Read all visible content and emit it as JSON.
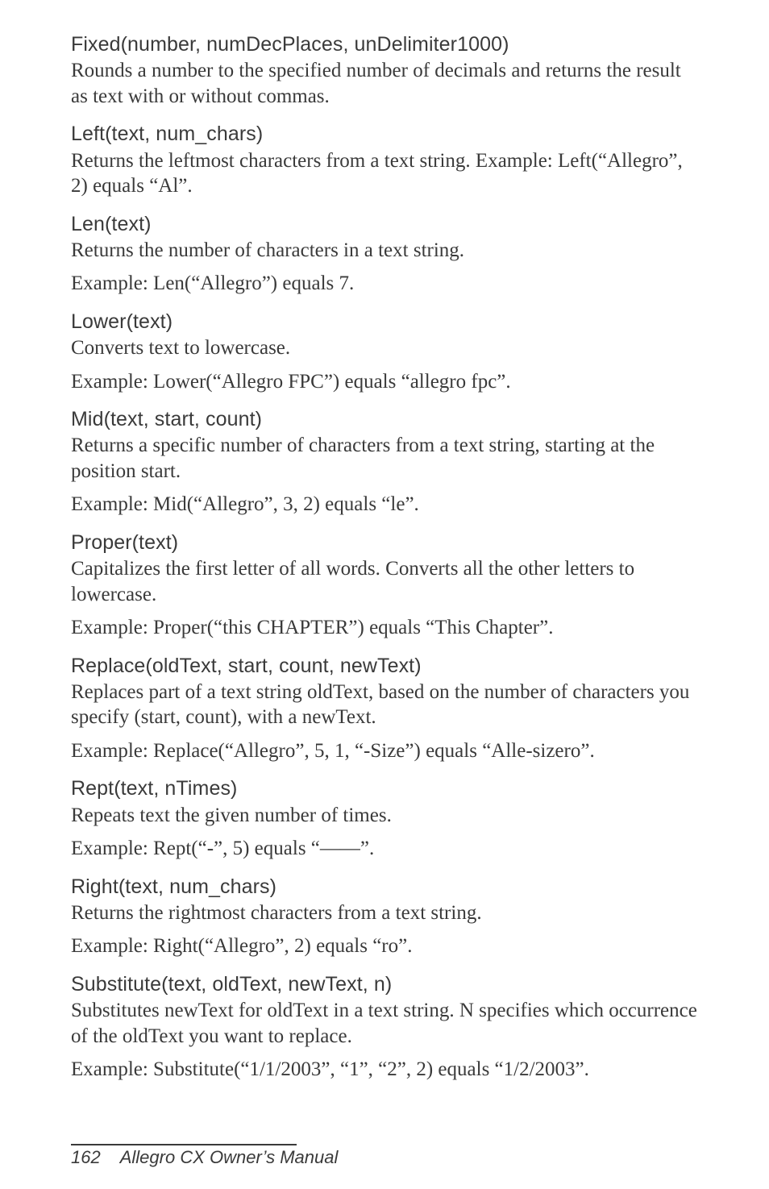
{
  "sections": [
    {
      "title": "Fixed(number, numDecPlaces, unDelimiter1000)",
      "paras": [
        "Rounds a number to the specified number of decimals and returns the result as text with or without commas."
      ]
    },
    {
      "title": "Left(text, num_chars)",
      "paras": [
        "Returns the leftmost characters from a text string. Example: Left(“Allegro”, 2) equals “Al”."
      ]
    },
    {
      "title": "Len(text)",
      "paras": [
        "Returns the number of characters in a text string.",
        "Example: Len(“Allegro”) equals 7."
      ]
    },
    {
      "title": "Lower(text)",
      "paras": [
        "Converts text to lowercase.",
        "Example: Lower(“Allegro FPC”) equals “allegro fpc”."
      ]
    },
    {
      "title": "Mid(text, start, count)",
      "paras": [
        "Returns a specific number of characters from a text string, starting at the position start.",
        "Example: Mid(“Allegro”, 3, 2) equals “le”."
      ]
    },
    {
      "title": "Proper(text)",
      "paras": [
        "Capitalizes the first letter of all words. Converts all the other letters to lowercase.",
        "Example: Proper(“this CHAPTER”) equals “This Chapter”."
      ]
    },
    {
      "title": "Replace(oldText, start, count, newText)",
      "paras": [
        "Replaces part of a text string oldText, based on the number of characters you specify (start, count), with a newText.",
        "Example: Replace(“Allegro”, 5, 1, “-Size”) equals “Alle-sizero”."
      ]
    },
    {
      "title": "Rept(text, nTimes)",
      "paras": [
        "Repeats text the given number of times.",
        "Example: Rept(“-”, 5) equals “——”."
      ]
    },
    {
      "title": "Right(text, num_chars)",
      "paras": [
        "Returns the rightmost characters from a text string.",
        "Example: Right(“Allegro”, 2) equals “ro”."
      ]
    },
    {
      "title": "Substitute(text, oldText, newText, n)",
      "paras": [
        "Substitutes newText for oldText in a text string. N specifies which occurrence of the oldText you want to replace.",
        "Example: Substitute(“1/1/2003”, “1”, “2”, 2) equals “1/2/2003”."
      ]
    }
  ],
  "footer": {
    "page": "162",
    "title": "Allegro CX Owner’s Manual"
  }
}
